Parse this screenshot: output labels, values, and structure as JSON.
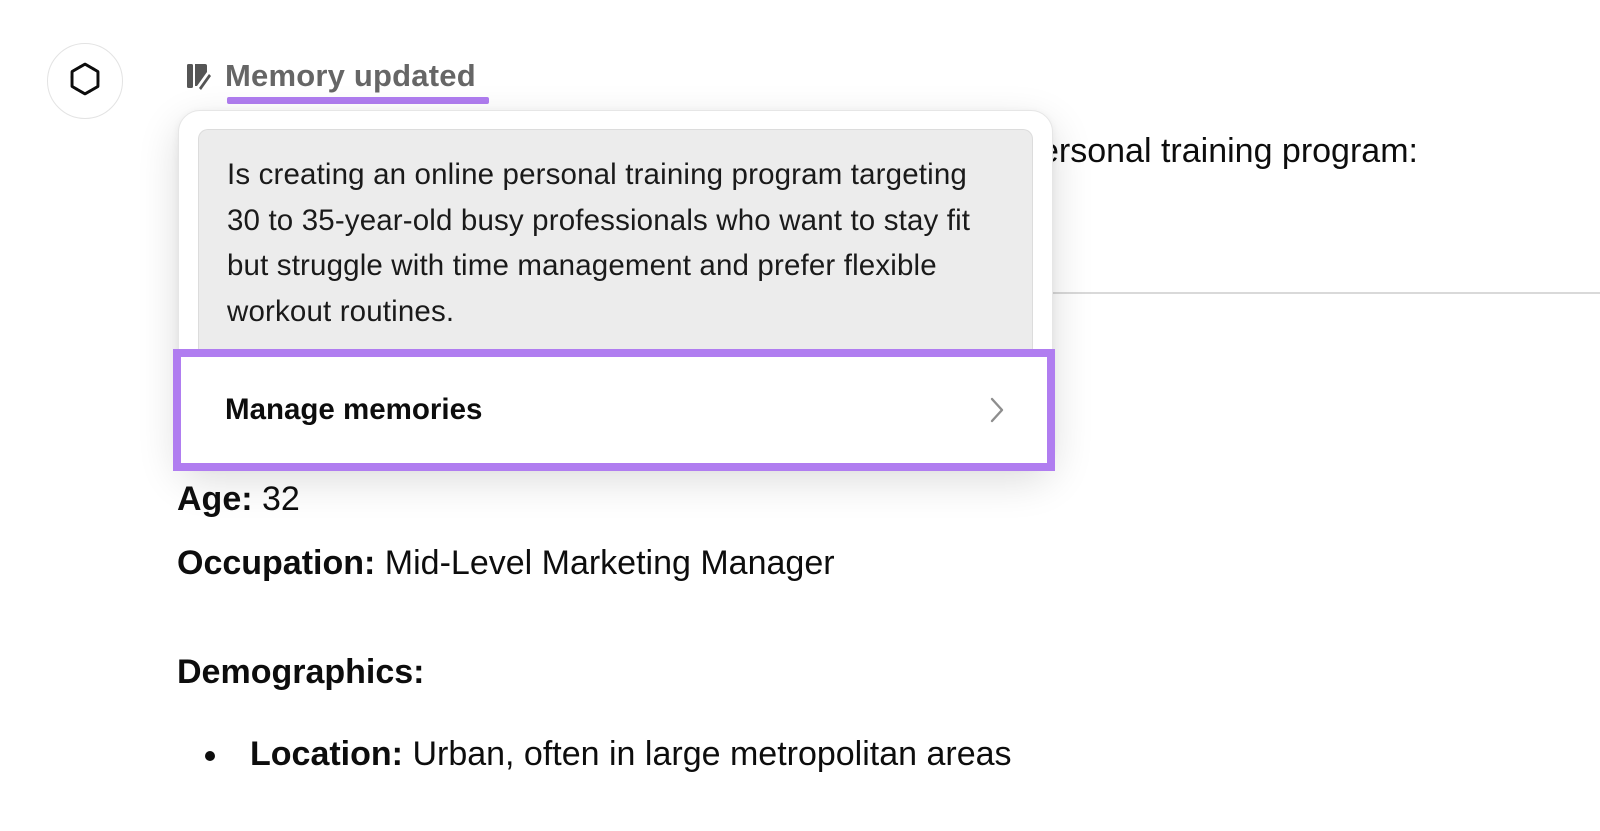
{
  "assistant": {
    "avatar_icon": "openai-logo-icon"
  },
  "memory": {
    "icon": "memory-edit-icon",
    "label": "Memory updated",
    "accent_color": "#b07df0",
    "content": "Is creating an online personal training program targeting 30 to 35-year-old busy professionals who want to stay fit but struggle with time management and prefer flexible workout routines.",
    "manage_label": "Manage memories",
    "manage_icon": "chevron-right-icon"
  },
  "message": {
    "partial_intro": "ersonal training program:",
    "age_label": "Age:",
    "age_value": "32",
    "occupation_label": "Occupation:",
    "occupation_value": "Mid-Level Marketing Manager",
    "demographics_heading": "Demographics:",
    "location_label": "Location:",
    "location_value": "Urban, often in large metropolitan areas"
  }
}
